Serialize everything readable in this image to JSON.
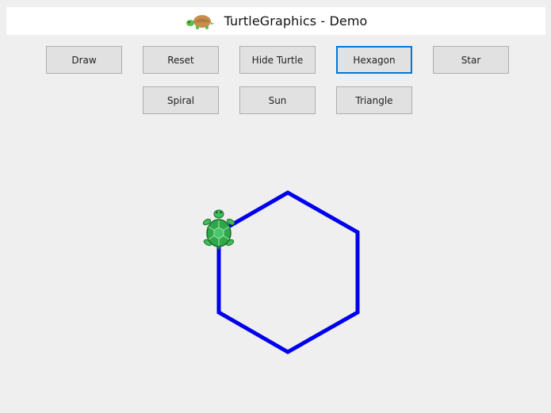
{
  "window": {
    "title": "TurtleGraphics - Demo"
  },
  "buttons": [
    {
      "id": "draw",
      "label": "Draw"
    },
    {
      "id": "reset",
      "label": "Reset"
    },
    {
      "id": "hide-turtle",
      "label": "Hide Turtle"
    },
    {
      "id": "hexagon",
      "label": "Hexagon"
    },
    {
      "id": "star",
      "label": "Star"
    },
    {
      "id": "spiral",
      "label": "Spiral"
    },
    {
      "id": "sun",
      "label": "Sun"
    },
    {
      "id": "triangle",
      "label": "Triangle"
    }
  ],
  "focused_button": "Hexagon",
  "drawing": {
    "shape": "hexagon",
    "stroke_color": "#0000ee"
  },
  "icons": {
    "title": "turtle-icon",
    "turtle": "turtle-icon"
  }
}
